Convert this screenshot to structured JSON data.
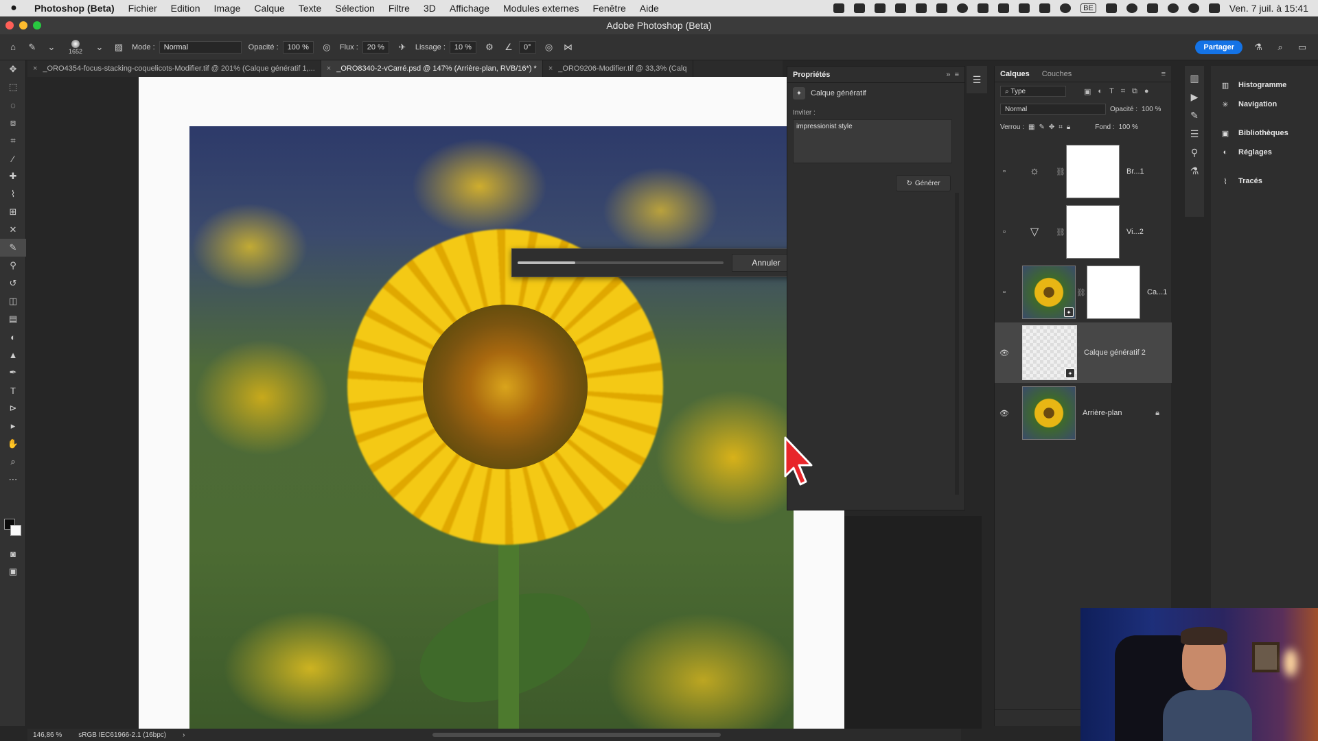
{
  "menubar": {
    "apple": "",
    "app_name": "Photoshop (Beta)",
    "items": [
      "Fichier",
      "Edition",
      "Image",
      "Calque",
      "Texte",
      "Sélection",
      "Filtre",
      "3D",
      "Affichage",
      "Modules externes",
      "Fenêtre",
      "Aide"
    ],
    "input_badge": "BE",
    "clock": "Ven. 7 juil. à 15:41"
  },
  "window": {
    "title": "Adobe Photoshop (Beta)"
  },
  "options": {
    "brush_size": "1652",
    "mode_label": "Mode :",
    "mode_value": "Normal",
    "opacity_label": "Opacité :",
    "opacity_value": "100 %",
    "flow_label": "Flux :",
    "flow_value": "20 %",
    "smoothing_label": "Lissage :",
    "smoothing_value": "10 %",
    "angle_value": "0°",
    "share_label": "Partager"
  },
  "tabs": [
    {
      "label": "_ORO4354-focus-stacking-coquelicots-Modifier.tif @ 201% (Calque génératif 1,...",
      "active": false
    },
    {
      "label": "_ORO8340-2-vCarré.psd @ 147% (Arrière-plan, RVB/16*) *",
      "active": true
    },
    {
      "label": "_ORO9206-Modifier.tif @ 33,3% (Calq",
      "active": false
    }
  ],
  "progress": {
    "value": 0.28,
    "cancel_label": "Annuler"
  },
  "properties": {
    "title": "Propriétés",
    "layer_type": "Calque génératif",
    "prompt_label": "Inviter :",
    "prompt_value": "impressionist style",
    "generate_label": "Générer"
  },
  "layers_panel": {
    "tab_layers": "Calques",
    "tab_channels": "Couches",
    "filter_value": "Type",
    "blend_value": "Normal",
    "opacity_label": "Opacité :",
    "opacity_value": "100 %",
    "lock_label": "Verrou :",
    "fill_label": "Fond :",
    "fill_value": "100 %",
    "layers": [
      {
        "name": "Br...1",
        "kind": "adjustment",
        "icon": "brightness-icon",
        "visible": false
      },
      {
        "name": "Vi...2",
        "kind": "adjustment",
        "icon": "vibrance-icon",
        "visible": false
      },
      {
        "name": "Ca...1",
        "kind": "generative-photo",
        "visible": false
      },
      {
        "name": "Calque génératif 2",
        "kind": "generative-empty",
        "visible": true,
        "selected": true
      },
      {
        "name": "Arrière-plan",
        "kind": "background",
        "visible": true,
        "locked": true
      }
    ]
  },
  "right_panels": {
    "items": [
      "Histogramme",
      "Navigation",
      "Bibliothèques",
      "Réglages",
      "Tracés"
    ]
  },
  "status": {
    "zoom": "146,86 %",
    "profile": "sRGB IEC61966-2.1 (16bpc)",
    "arrow": "›"
  },
  "colors": {
    "accent": "#1473e6",
    "cursor": "#e8262a"
  }
}
